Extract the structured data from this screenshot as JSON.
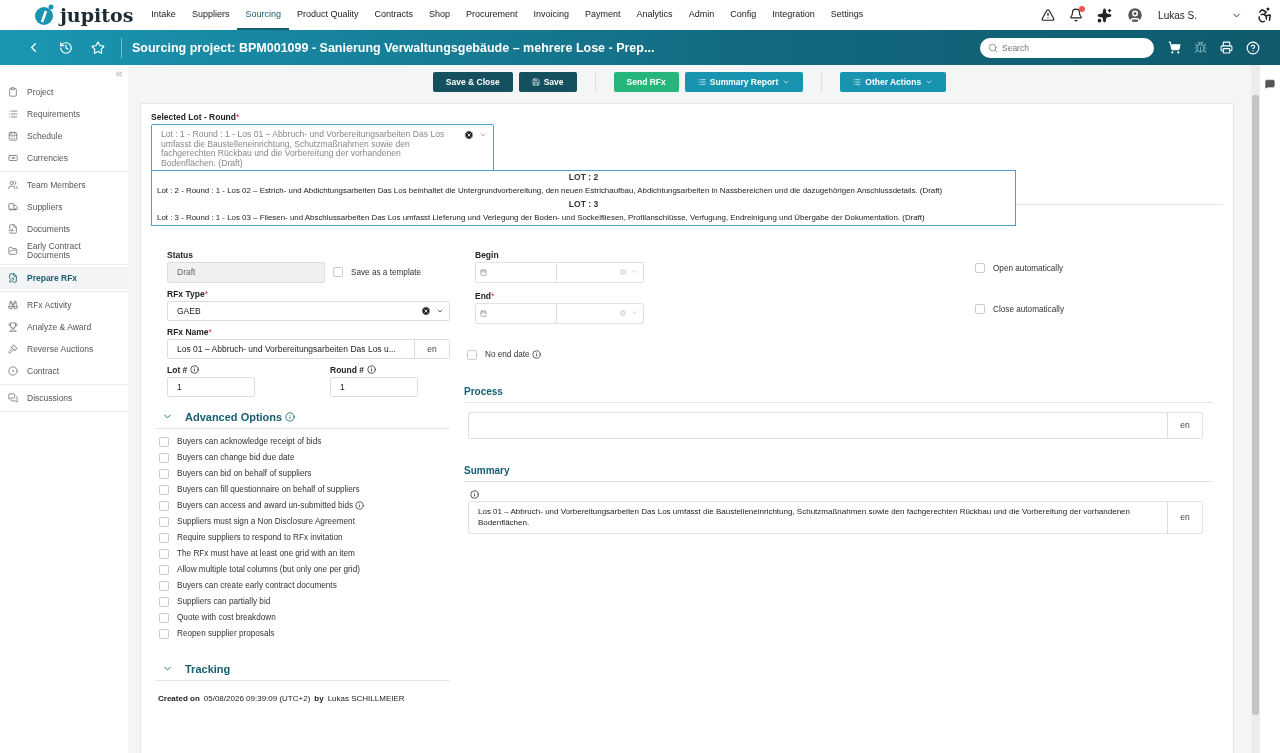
{
  "nav": {
    "logo": "jupitos",
    "items": [
      {
        "label": "Intake",
        "selected": false
      },
      {
        "label": "Suppliers",
        "selected": false
      },
      {
        "label": "Sourcing",
        "selected": true
      },
      {
        "label": "Product Quality",
        "selected": false
      },
      {
        "label": "Contracts",
        "selected": false
      },
      {
        "label": "Shop",
        "selected": false
      },
      {
        "label": "Procurement",
        "selected": false
      },
      {
        "label": "Invoicing",
        "selected": false
      },
      {
        "label": "Payment",
        "selected": false
      },
      {
        "label": "Analytics",
        "selected": false
      },
      {
        "label": "Admin",
        "selected": false
      },
      {
        "label": "Config",
        "selected": false
      },
      {
        "label": "Integration",
        "selected": false
      },
      {
        "label": "Settings",
        "selected": false
      }
    ],
    "user": "Lukas S.",
    "has_notification": true
  },
  "header": {
    "title": "Sourcing project: BPM001099 - Sanierung Verwaltungsgebäude – mehrere Lose - Prep...",
    "search_placeholder": "Search"
  },
  "toolbar": [
    {
      "label": "Save & Close",
      "kind": "dark"
    },
    {
      "label": "Save",
      "kind": "dark-save"
    },
    {
      "label": "Send RFx",
      "kind": "green"
    },
    {
      "label": "Summary Report",
      "kind": "teal-menu"
    },
    {
      "label": "Other Actions",
      "kind": "teal-menu"
    }
  ],
  "sidebar": {
    "groups": [
      {
        "items": [
          {
            "label": "Project",
            "selected": false
          },
          {
            "label": "Requirements",
            "selected": false
          },
          {
            "label": "Schedule",
            "selected": false
          },
          {
            "label": "Currencies",
            "selected": false
          }
        ]
      },
      {
        "items": [
          {
            "label": "Team Members",
            "selected": false
          },
          {
            "label": "Suppliers",
            "selected": false
          },
          {
            "label": "Documents",
            "selected": false
          },
          {
            "label": "Early Contract Documents",
            "selected": false
          }
        ]
      },
      {
        "items": [
          {
            "label": "Prepare RFx",
            "selected": true
          }
        ]
      },
      {
        "items": [
          {
            "label": "RFx Activity",
            "selected": false
          },
          {
            "label": "Analyze & Award",
            "selected": false
          },
          {
            "label": "Reverse Auctions",
            "selected": false
          },
          {
            "label": "Contract",
            "selected": false
          }
        ]
      },
      {
        "items": [
          {
            "label": "Discussions",
            "selected": false
          }
        ]
      }
    ]
  },
  "lot_select": {
    "label": "Selected Lot - Round",
    "required_mark": "*",
    "value": "Lot : 1 - Round : 1 - Los 01 – Abbruch- und Vorbereitungsarbeiten Das Los umfasst die Baustelleneinrichtung, Schutzmaßnahmen sowie den fachgerechten Rückbau und die Vorbereitung der vorhandenen Bodenflächen. (Draft)",
    "expanded": true,
    "groups": [
      {
        "header": "LOT : 2",
        "options": [
          {
            "label": "Lot : 2 - Round : 1 - Los 02 – Estrich- und Abdichtungsarbeiten Das Los beinhaltet die Untergrundvorbereitung, den neuen Estrichaufbau, Abdichtungsarbeiten in Nassbereichen und die dazugehörigen Anschlussdetails. (Draft)",
            "selected": false
          }
        ]
      },
      {
        "header": "LOT : 3",
        "options": [
          {
            "label": "Lot : 3 - Round : 1 - Los 03 – Fliesen- und Abschlussarbeiten Das Los umfasst Lieferung und Verlegung der Boden- und Sockelfliesen, Profilanschlüsse, Verfugung, Endreinigung und Übergabe der Dokumentation. (Draft)",
            "selected": false
          }
        ]
      }
    ]
  },
  "settings": {
    "status": {
      "label": "Status",
      "value": "Draft",
      "disabled": true
    },
    "template": {
      "label": "Save as a template",
      "checked": false
    },
    "rfx_type": {
      "label": "RFx Type",
      "required_mark": "*",
      "value": "GAEB"
    },
    "rfx_name": {
      "label": "RFx Name",
      "required_mark": "*",
      "value": "Los 01 – Abbruch- und Vorbereitungsarbeiten Das Los u...",
      "lang": "en"
    },
    "lot": {
      "label": "Lot #",
      "value": "1"
    },
    "round": {
      "label": "Round #",
      "value": "1"
    }
  },
  "advanced": {
    "title": "Advanced Options",
    "expanded": true,
    "options": [
      {
        "label": "Buyers can acknowledge receipt of bids",
        "checked": false,
        "info": false
      },
      {
        "label": "Buyers can change bid due date",
        "checked": false,
        "info": false
      },
      {
        "label": "Buyers can bid on behalf of suppliers",
        "checked": false,
        "info": false
      },
      {
        "label": "Buyers can fill questionnaire on behalf of suppliers",
        "checked": false,
        "info": false
      },
      {
        "label": "Buyers can access and award un-submitted bids",
        "checked": false,
        "info": true
      },
      {
        "label": "Suppliers must sign a Non Disclosure Agreement",
        "checked": false,
        "info": false
      },
      {
        "label": "Require suppliers to respond to RFx invitation",
        "checked": false,
        "info": false
      },
      {
        "label": "The RFx must have at least one grid with an item",
        "checked": false,
        "info": false
      },
      {
        "label": "Allow multiple total columns (but only one per grid)",
        "checked": false,
        "info": false
      },
      {
        "label": "Buyers can create early contract documents",
        "checked": false,
        "info": false
      },
      {
        "label": "Suppliers can partially bid",
        "checked": false,
        "info": false
      },
      {
        "label": "Quote with cost breakdown",
        "checked": false,
        "info": false
      },
      {
        "label": "Reopen supplier proposals",
        "checked": false,
        "info": false
      }
    ]
  },
  "tracking": {
    "title": "Tracking",
    "expanded": true,
    "created_label": "Created on",
    "created_at": "05/08/2026 09:39:09 (UTC+2)",
    "by_label": "by",
    "created_by": "Lukas SCHILLMEIER"
  },
  "dates": {
    "begin": {
      "label": "Begin",
      "auto_label": "Open automatically",
      "auto_checked": false
    },
    "end": {
      "label": "End",
      "required_mark": "*",
      "auto_label": "Close automatically",
      "auto_checked": false
    },
    "no_end_date": {
      "label": "No end date",
      "checked": false
    }
  },
  "process": {
    "title": "Process",
    "lang": "en"
  },
  "summary": {
    "title": "Summary",
    "text": "Los 01 – Abbruch- und Vorbereitungsarbeiten Das Los umfasst die Baustelleneinrichtung, Schutzmaßnahmen sowie den fachgerechten Rückbau und die Vorbereitung der vorhandenen Bodenflächen.",
    "lang": "en"
  }
}
